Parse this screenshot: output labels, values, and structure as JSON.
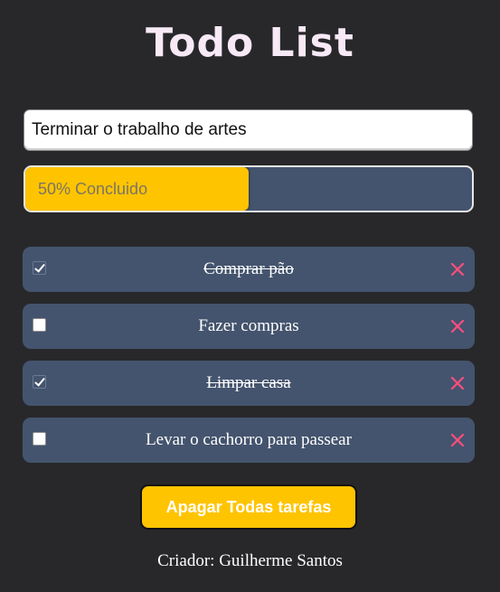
{
  "app": {
    "title": "Todo List"
  },
  "task_input": {
    "value": "Terminar o trabalho de artes"
  },
  "progress": {
    "percent": 50,
    "label": "50% Concluido"
  },
  "tasks": [
    {
      "text": "Comprar pão",
      "done": true
    },
    {
      "text": "Fazer compras",
      "done": false
    },
    {
      "text": "Limpar casa",
      "done": true
    },
    {
      "text": "Levar o cachorro para passear",
      "done": false
    }
  ],
  "delete_icon": "close-icon",
  "colors": {
    "background": "#28282b",
    "card": "#44546e",
    "accent": "#ffc400",
    "delete": "#ff4d7d"
  },
  "clear_button": {
    "label": "Apagar Todas tarefas"
  },
  "footer": {
    "text": "Criador: Guilherme Santos"
  }
}
